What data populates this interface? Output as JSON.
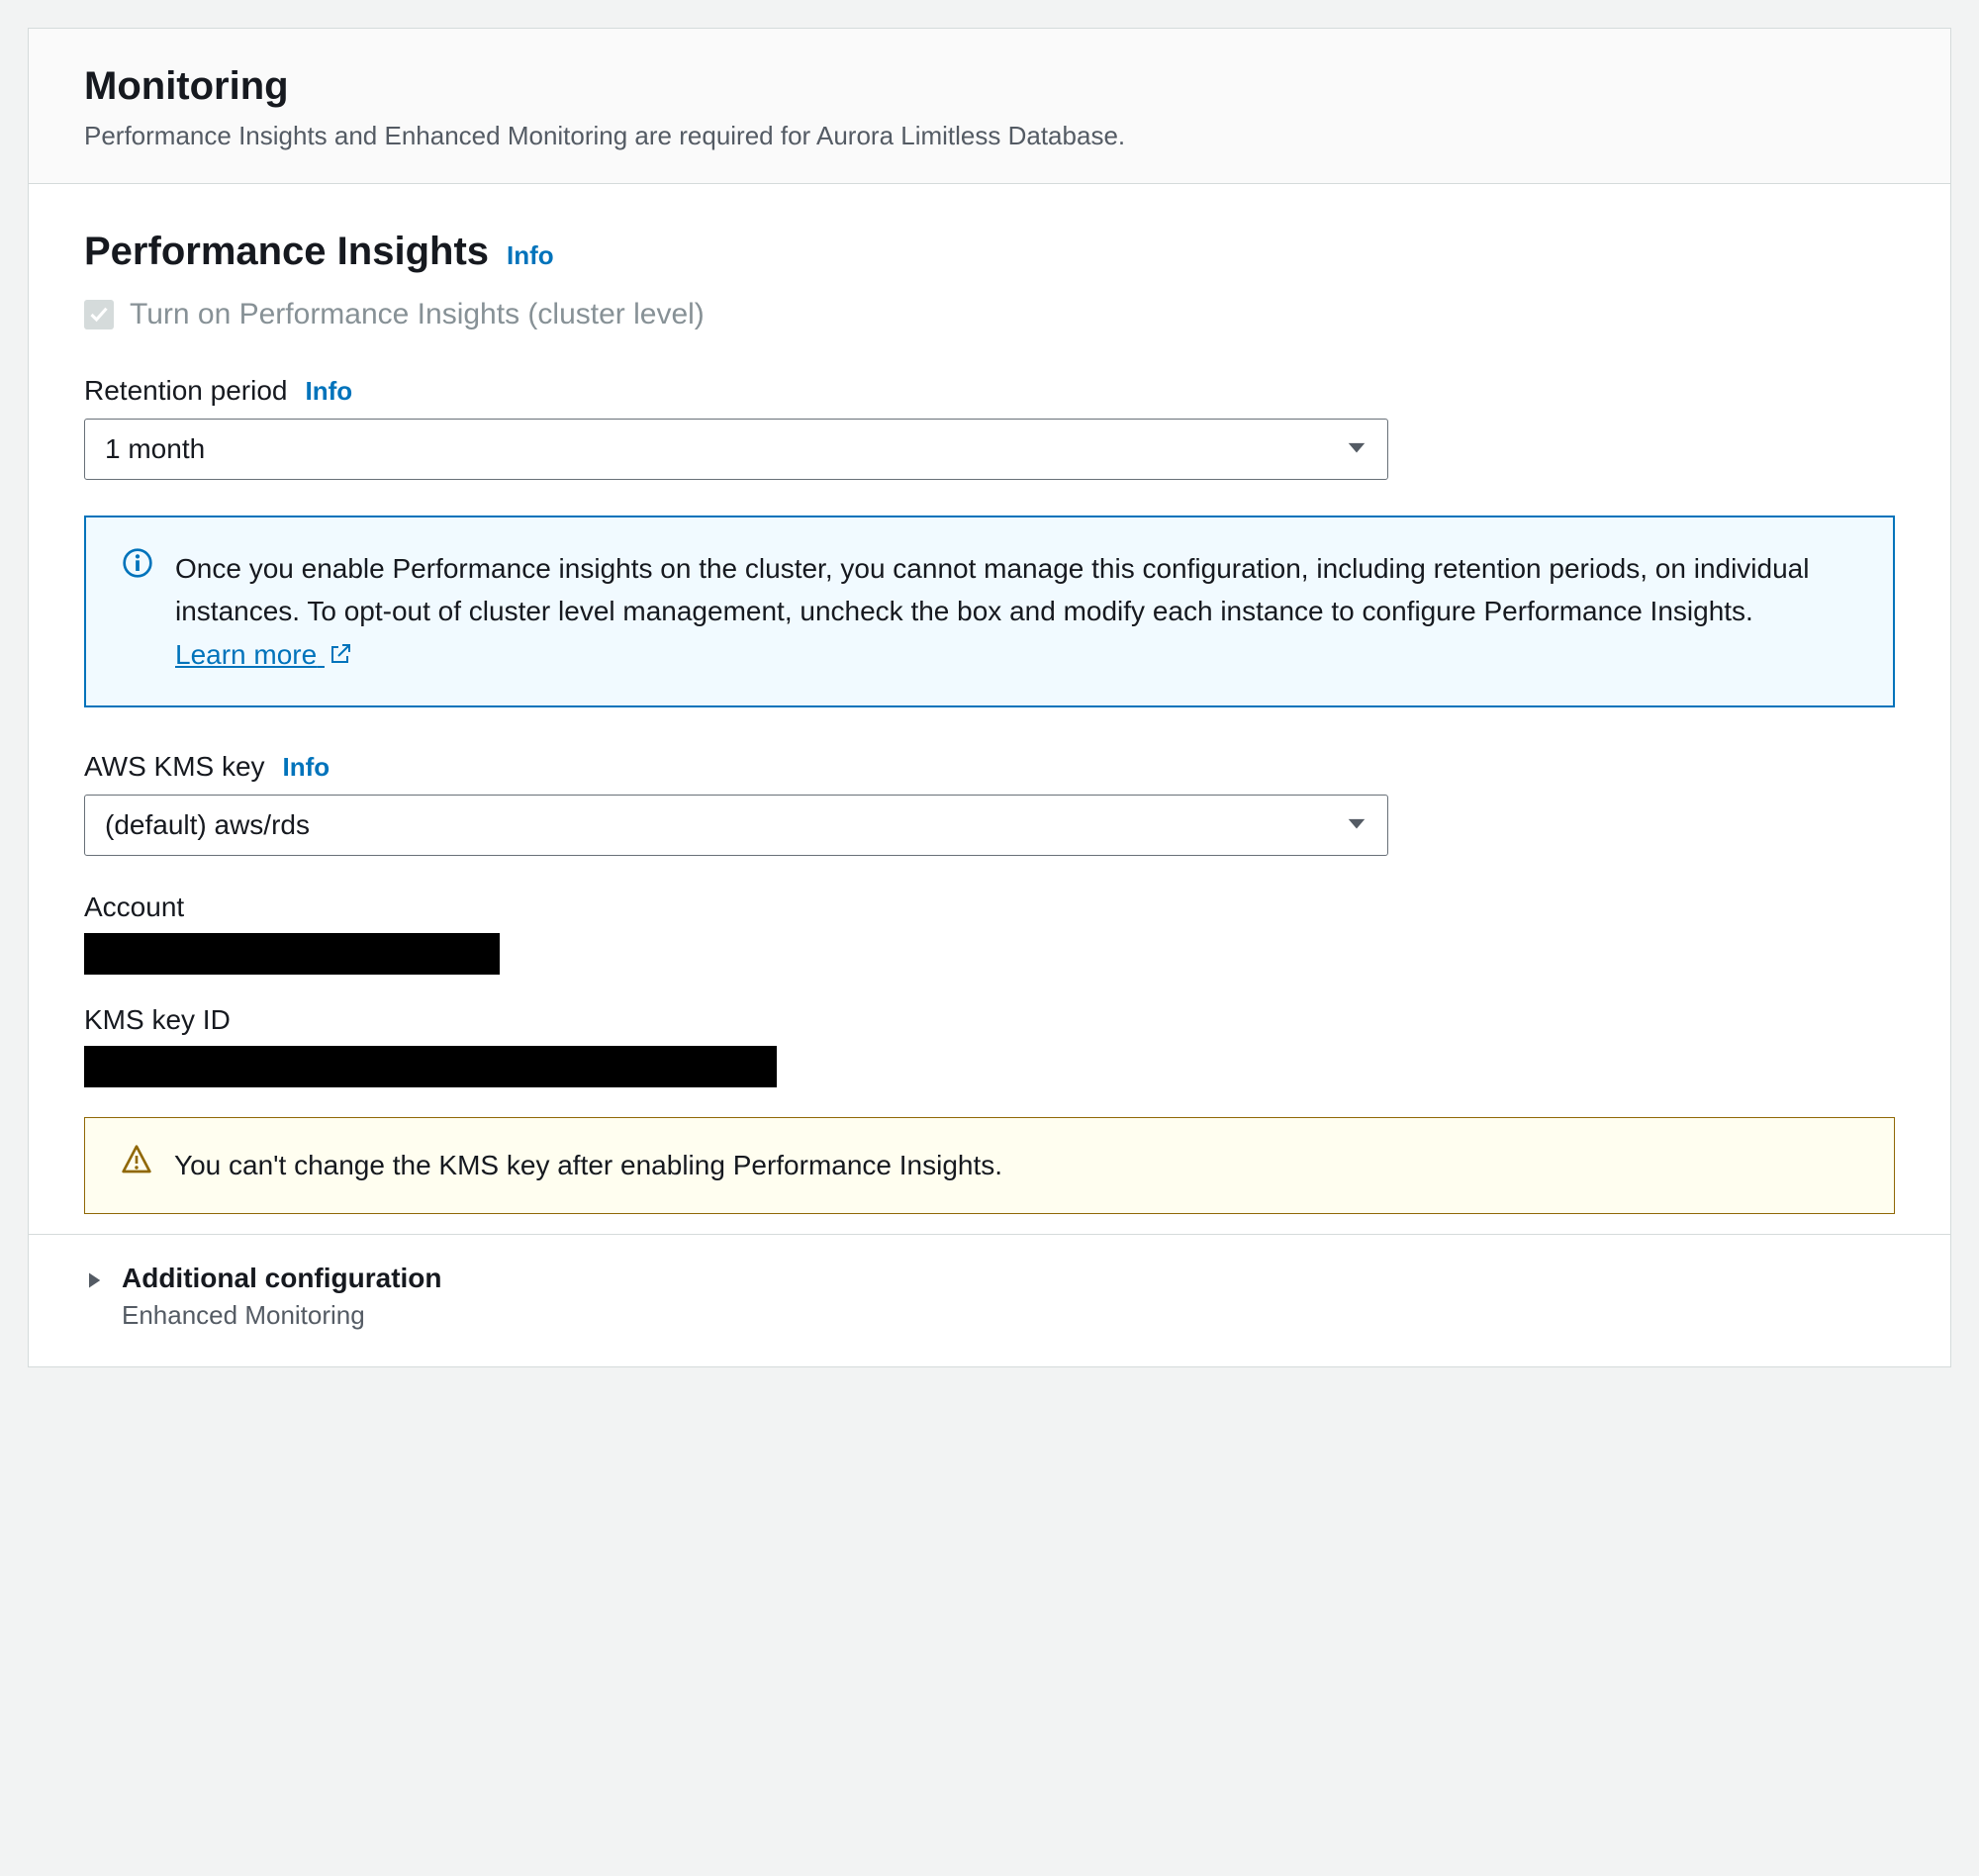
{
  "header": {
    "title": "Monitoring",
    "description": "Performance Insights and Enhanced Monitoring are required for Aurora Limitless Database."
  },
  "pi": {
    "section_title": "Performance Insights",
    "info": "Info",
    "checkbox_label": "Turn on Performance Insights (cluster level)",
    "retention": {
      "label": "Retention period",
      "info": "Info",
      "value": "1 month"
    },
    "alert_text": "Once you enable Performance insights on the cluster, you cannot manage this configuration, including retention periods, on individual instances. To opt-out of cluster level management, uncheck the box and modify each instance to configure Performance Insights. ",
    "learn_more": "Learn more",
    "kms": {
      "label": "AWS KMS key",
      "info": "Info",
      "value": "(default) aws/rds"
    },
    "account_label": "Account",
    "kms_key_id_label": "KMS key ID",
    "warn_text": "You can't change the KMS key after enabling Performance Insights."
  },
  "additional": {
    "title": "Additional configuration",
    "subtitle": "Enhanced Monitoring"
  }
}
